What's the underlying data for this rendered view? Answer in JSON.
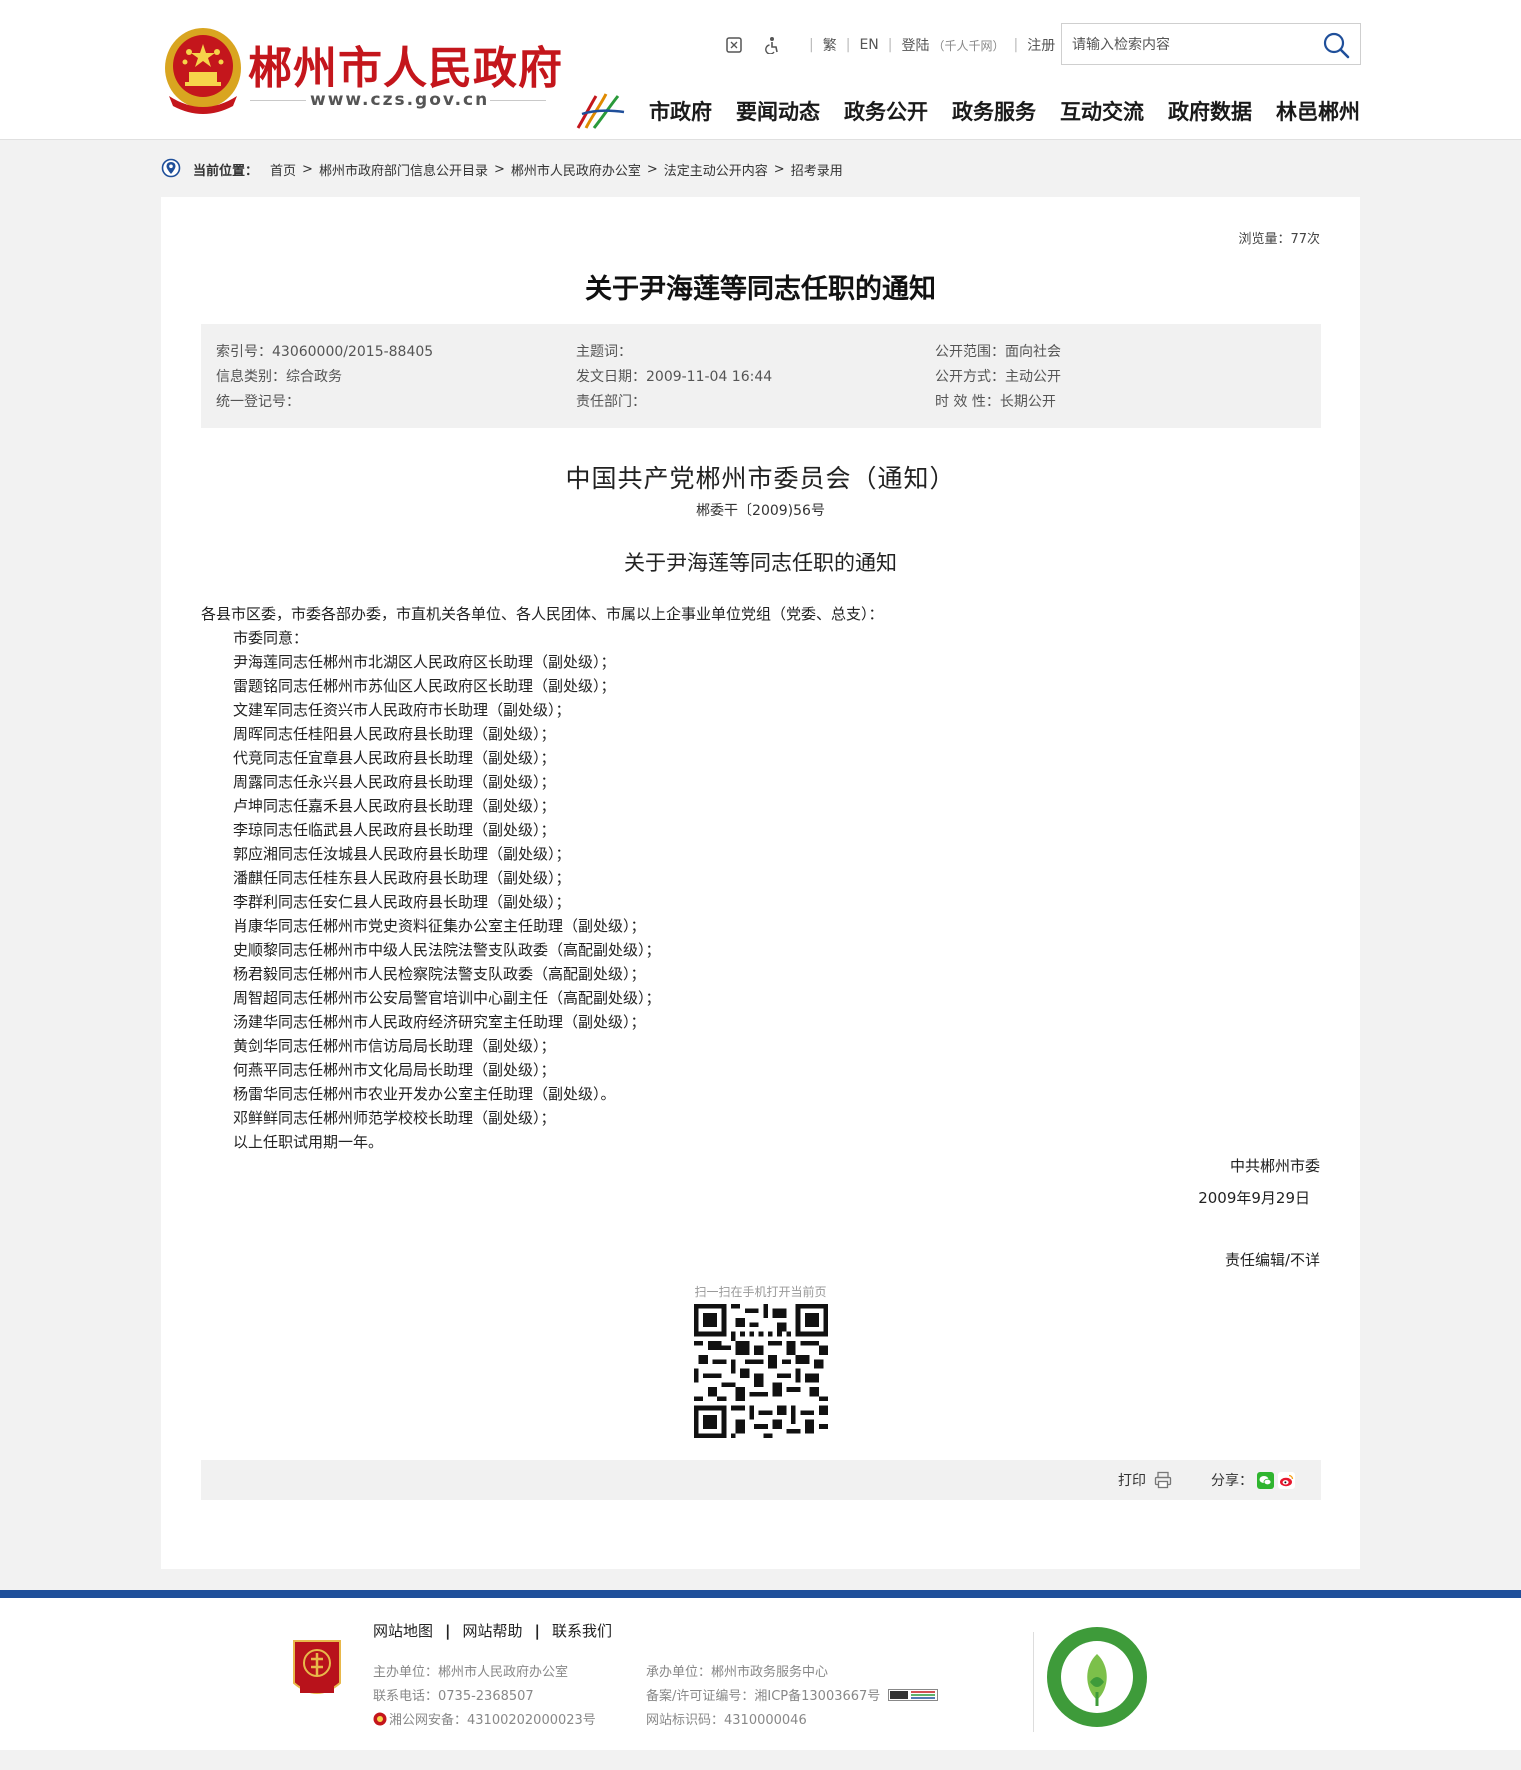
{
  "header": {
    "site_name": "郴州市人民政府",
    "site_url": "www.czs.gov.cn",
    "tools": {
      "traditional": "繁",
      "english": "EN",
      "login": "登陆",
      "login_note": "（千人千网）",
      "register": "注册"
    },
    "search": {
      "placeholder": "请输入检索内容"
    },
    "nav": [
      "市政府",
      "要闻动态",
      "政务公开",
      "政务服务",
      "互动交流",
      "政府数据",
      "林邑郴州"
    ]
  },
  "breadcrumb": {
    "label": "当前位置：",
    "items": [
      "首页",
      "郴州市政府部门信息公开目录",
      "郴州市人民政府办公室",
      "法定主动公开内容",
      "招考录用"
    ],
    "separator": ">"
  },
  "article": {
    "views": "浏览量：77次",
    "title": "关于尹海莲等同志任职的通知",
    "meta": {
      "index_no": "索引号：43060000/2015-88405",
      "category": "信息类别：综合政务",
      "reg_no": "统一登记号：",
      "keywords": "主题词：",
      "publish_date": "发文日期：2009-11-04 16:44",
      "dept": "责任部门：",
      "scope": "公开范围：面向社会",
      "method": "公开方式：主动公开",
      "validity": "时 效 性：长期公开"
    },
    "doc_org": "中国共产党郴州市委员会（通知）",
    "doc_no": "郴委干〔2009)56号",
    "doc_subtitle": "关于尹海莲等同志任职的通知",
    "salutation": "各县市区委，市委各部办委，市直机关各单位、各人民团体、市属以上企事业单位党组（党委、总支）：",
    "lines": [
      "市委同意：",
      "尹海莲同志任郴州市北湖区人民政府区长助理（副处级）；",
      "雷题铭同志任郴州市苏仙区人民政府区长助理（副处级）；",
      "文建军同志任资兴市人民政府市长助理（副处级）；",
      "周晖同志任桂阳县人民政府县长助理（副处级）；",
      "代竞同志任宜章县人民政府县长助理（副处级）；",
      "周露同志任永兴县人民政府县长助理（副处级）；",
      "卢坤同志任嘉禾县人民政府县长助理（副处级）；",
      "李琼同志任临武县人民政府县长助理（副处级）；",
      "郭应湘同志任汝城县人民政府县长助理（副处级）；",
      "潘麒任同志任桂东县人民政府县长助理（副处级）；",
      "李群利同志任安仁县人民政府县长助理（副处级）；",
      "肖康华同志任郴州市党史资料征集办公室主任助理（副处级）；",
      "史顺黎同志任郴州市中级人民法院法警支队政委（高配副处级）；",
      "杨君毅同志任郴州市人民检察院法警支队政委（高配副处级）；",
      "周智超同志任郴州市公安局警官培训中心副主任（高配副处级）；",
      "汤建华同志任郴州市人民政府经济研究室主任助理（副处级）；",
      "黄剑华同志任郴州市信访局局长助理（副处级）；",
      "何燕平同志任郴州市文化局局长助理（副处级）；",
      "杨雷华同志任郴州市农业开发办公室主任助理（副处级）。",
      "邓鲜鲜同志任郴州师范学校校长助理（副处级）；",
      "以上任职试用期一年。"
    ],
    "sign_org": "中共郴州市委",
    "sign_date": "2009年9月29日",
    "editor": "责任编辑/不详",
    "qr_tip": "扫一扫在手机打开当前页",
    "print_label": "打印",
    "share_label": "分享："
  },
  "footer": {
    "links": [
      "网站地图",
      "网站帮助",
      "联系我们"
    ],
    "link_sep": "|",
    "sponsor": "主办单位：郴州市人民政府办公室",
    "phone": "联系电话：0735-2368507",
    "police": "湘公网安备：43100202000023号",
    "host": "承办单位：郴州市政务服务中心",
    "icp": "备案/许可证编号：湘ICP备13003667号",
    "site_code": "网站标识码：4310000046",
    "party_badge_text": "党政机关"
  },
  "colors": {
    "brand_red": "#c4161c",
    "footer_blue": "#1f4f9a"
  }
}
